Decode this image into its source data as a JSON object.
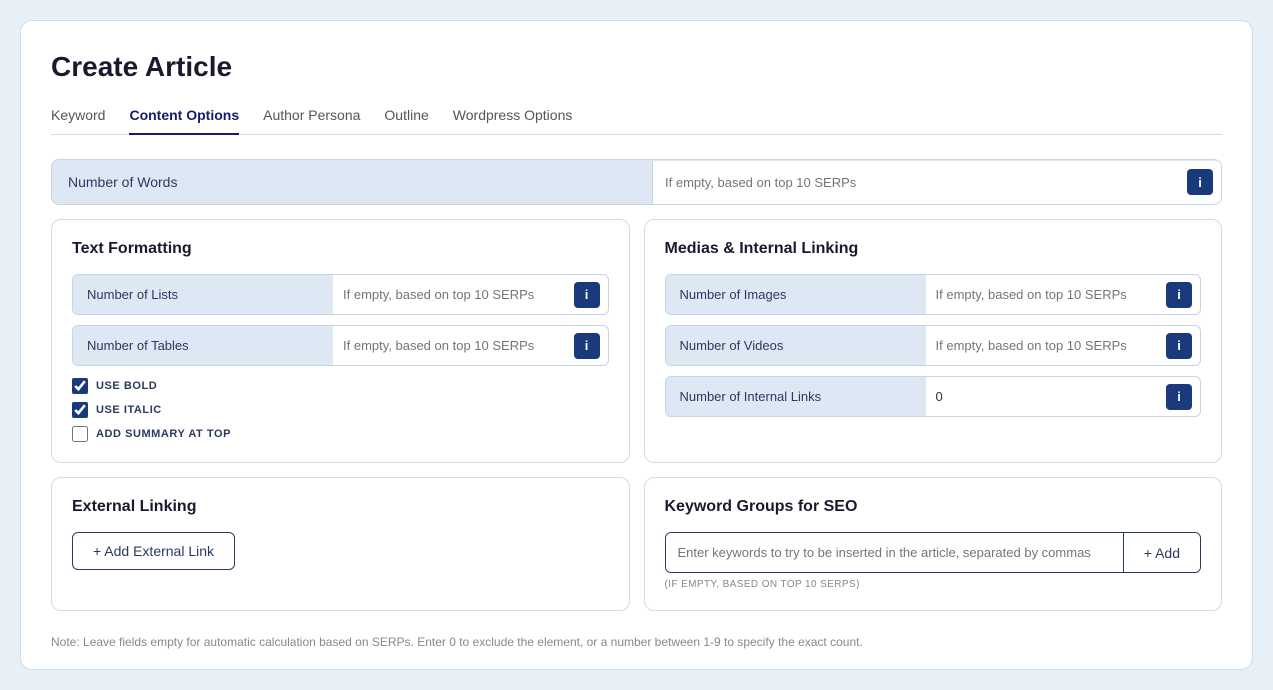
{
  "page": {
    "title": "Create Article"
  },
  "tabs": [
    {
      "id": "keyword",
      "label": "Keyword",
      "active": false
    },
    {
      "id": "content-options",
      "label": "Content Options",
      "active": true
    },
    {
      "id": "author-persona",
      "label": "Author Persona",
      "active": false
    },
    {
      "id": "outline",
      "label": "Outline",
      "active": false
    },
    {
      "id": "wordpress-options",
      "label": "Wordpress Options",
      "active": false
    }
  ],
  "words_row": {
    "label": "Number of Words",
    "placeholder": "If empty, based on top 10 SERPs"
  },
  "text_formatting": {
    "title": "Text Formatting",
    "fields": [
      {
        "label": "Number of Lists",
        "placeholder": "If empty, based on top 10 SERPs",
        "value": ""
      },
      {
        "label": "Number of Tables",
        "placeholder": "If empty, based on top 10 SERPs",
        "value": ""
      }
    ],
    "checkboxes": [
      {
        "id": "use-bold",
        "label": "USE BOLD",
        "checked": true
      },
      {
        "id": "use-italic",
        "label": "USE ITALIC",
        "checked": true
      },
      {
        "id": "add-summary",
        "label": "ADD SUMMARY AT TOP",
        "checked": false
      }
    ]
  },
  "medias_linking": {
    "title": "Medias & Internal Linking",
    "fields": [
      {
        "label": "Number of Images",
        "placeholder": "If empty, based on top 10 SERPs",
        "value": ""
      },
      {
        "label": "Number of Videos",
        "placeholder": "If empty, based on top 10 SERPs",
        "value": ""
      },
      {
        "label": "Number of Internal Links",
        "placeholder": "",
        "value": "0"
      }
    ]
  },
  "external_linking": {
    "title": "External Linking",
    "add_button": "+ Add External Link"
  },
  "keyword_seo": {
    "title": "Keyword Groups for SEO",
    "placeholder": "Enter keywords to try to be inserted in the article, separated by commas",
    "hint": "(IF EMPTY, BASED ON TOP 10 SERPS)",
    "add_button": "+ Add"
  },
  "note": "Note: Leave fields empty for automatic calculation based on SERPs. Enter 0 to exclude the element, or a number between 1-9 to specify the exact count."
}
